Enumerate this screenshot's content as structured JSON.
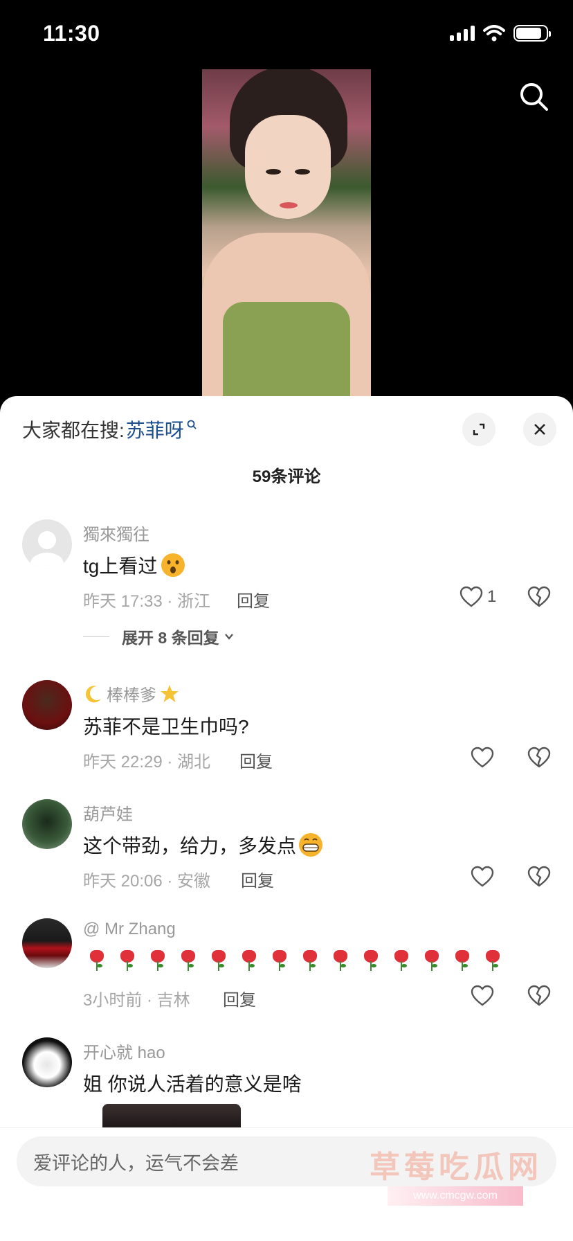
{
  "status_bar": {
    "time": "11:30"
  },
  "sheet": {
    "hot_search_label": "大家都在搜:",
    "hot_search_keyword": "苏菲呀",
    "comment_count": "59条评论"
  },
  "comments": [
    {
      "username": "獨來獨往",
      "text": "tg上看过",
      "meta": "昨天 17:33 · 浙江",
      "reply": "回复",
      "likes": "1",
      "expand": "展开 8 条回复"
    },
    {
      "username": "棒棒爹",
      "text": "苏菲不是卫生巾吗?",
      "meta": "昨天 22:29 · 湖北",
      "reply": "回复"
    },
    {
      "username": "葫芦娃",
      "text": "这个带劲，给力，多发点",
      "meta": "昨天 20:06 · 安徽",
      "reply": "回复"
    },
    {
      "username": "@ Mr Zhang",
      "text_emoji": "rose x14",
      "meta": "3小时前 · 吉林",
      "reply": "回复"
    },
    {
      "username": "开心就 hao",
      "text": "姐 你说人活着的意义是啥"
    }
  ],
  "input": {
    "placeholder": "爱评论的人，运气不会差"
  },
  "watermark": {
    "text": "草莓吃瓜网",
    "url": "www.cmcgw.com"
  },
  "colors": {
    "keyword_blue": "#1c4f8e",
    "muted": "#999999",
    "text": "#1a1a1a"
  }
}
